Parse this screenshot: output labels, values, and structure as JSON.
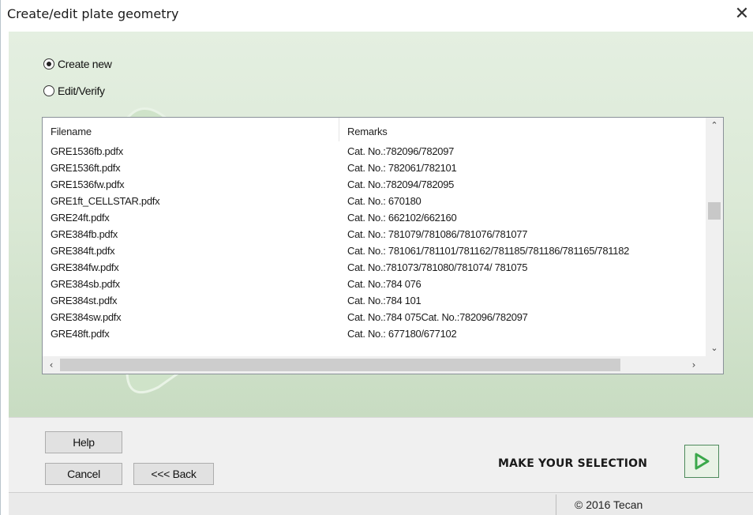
{
  "window": {
    "title": "Create/edit plate geometry",
    "close_icon": "close-icon",
    "close_glyph": "✕"
  },
  "options": {
    "create_new": {
      "label": "Create new",
      "selected": true
    },
    "edit_verify": {
      "label": "Edit/Verify",
      "selected": false
    }
  },
  "list": {
    "columns": [
      "Filename",
      "Remarks"
    ],
    "rows": [
      [
        "GRE1536fb.pdfx",
        "Cat. No.:782096/782097"
      ],
      [
        "GRE1536ft.pdfx",
        "Cat. No.: 782061/782101"
      ],
      [
        "GRE1536fw.pdfx",
        "Cat. No.:782094/782095"
      ],
      [
        "GRE1ft_CELLSTAR.pdfx",
        "Cat. No.: 670180"
      ],
      [
        "GRE24ft.pdfx",
        "Cat. No.: 662102/662160"
      ],
      [
        "GRE384fb.pdfx",
        "Cat. No.: 781079/781086/781076/781077"
      ],
      [
        "GRE384ft.pdfx",
        "Cat. No.: 781061/781101/781162/781185/781186/781165/781182"
      ],
      [
        "GRE384fw.pdfx",
        "Cat. No.:781073/781080/781074/ 781075"
      ],
      [
        "GRE384sb.pdfx",
        "Cat. No.:784 076"
      ],
      [
        "GRE384st.pdfx",
        "Cat. No.:784 101"
      ],
      [
        "GRE384sw.pdfx",
        "Cat. No.:784 075Cat. No.:782096/782097"
      ],
      [
        "GRE48ft.pdfx",
        "Cat. No.: 677180/677102"
      ]
    ]
  },
  "buttons": {
    "help": "Help",
    "cancel": "Cancel",
    "back": "<<< Back"
  },
  "prompt": "MAKE YOUR SELECTION",
  "status": {
    "copyright": "© 2016 Tecan"
  },
  "colors": {
    "accent_green": "#4d8a5b",
    "background_green": "#dbe9d6"
  }
}
